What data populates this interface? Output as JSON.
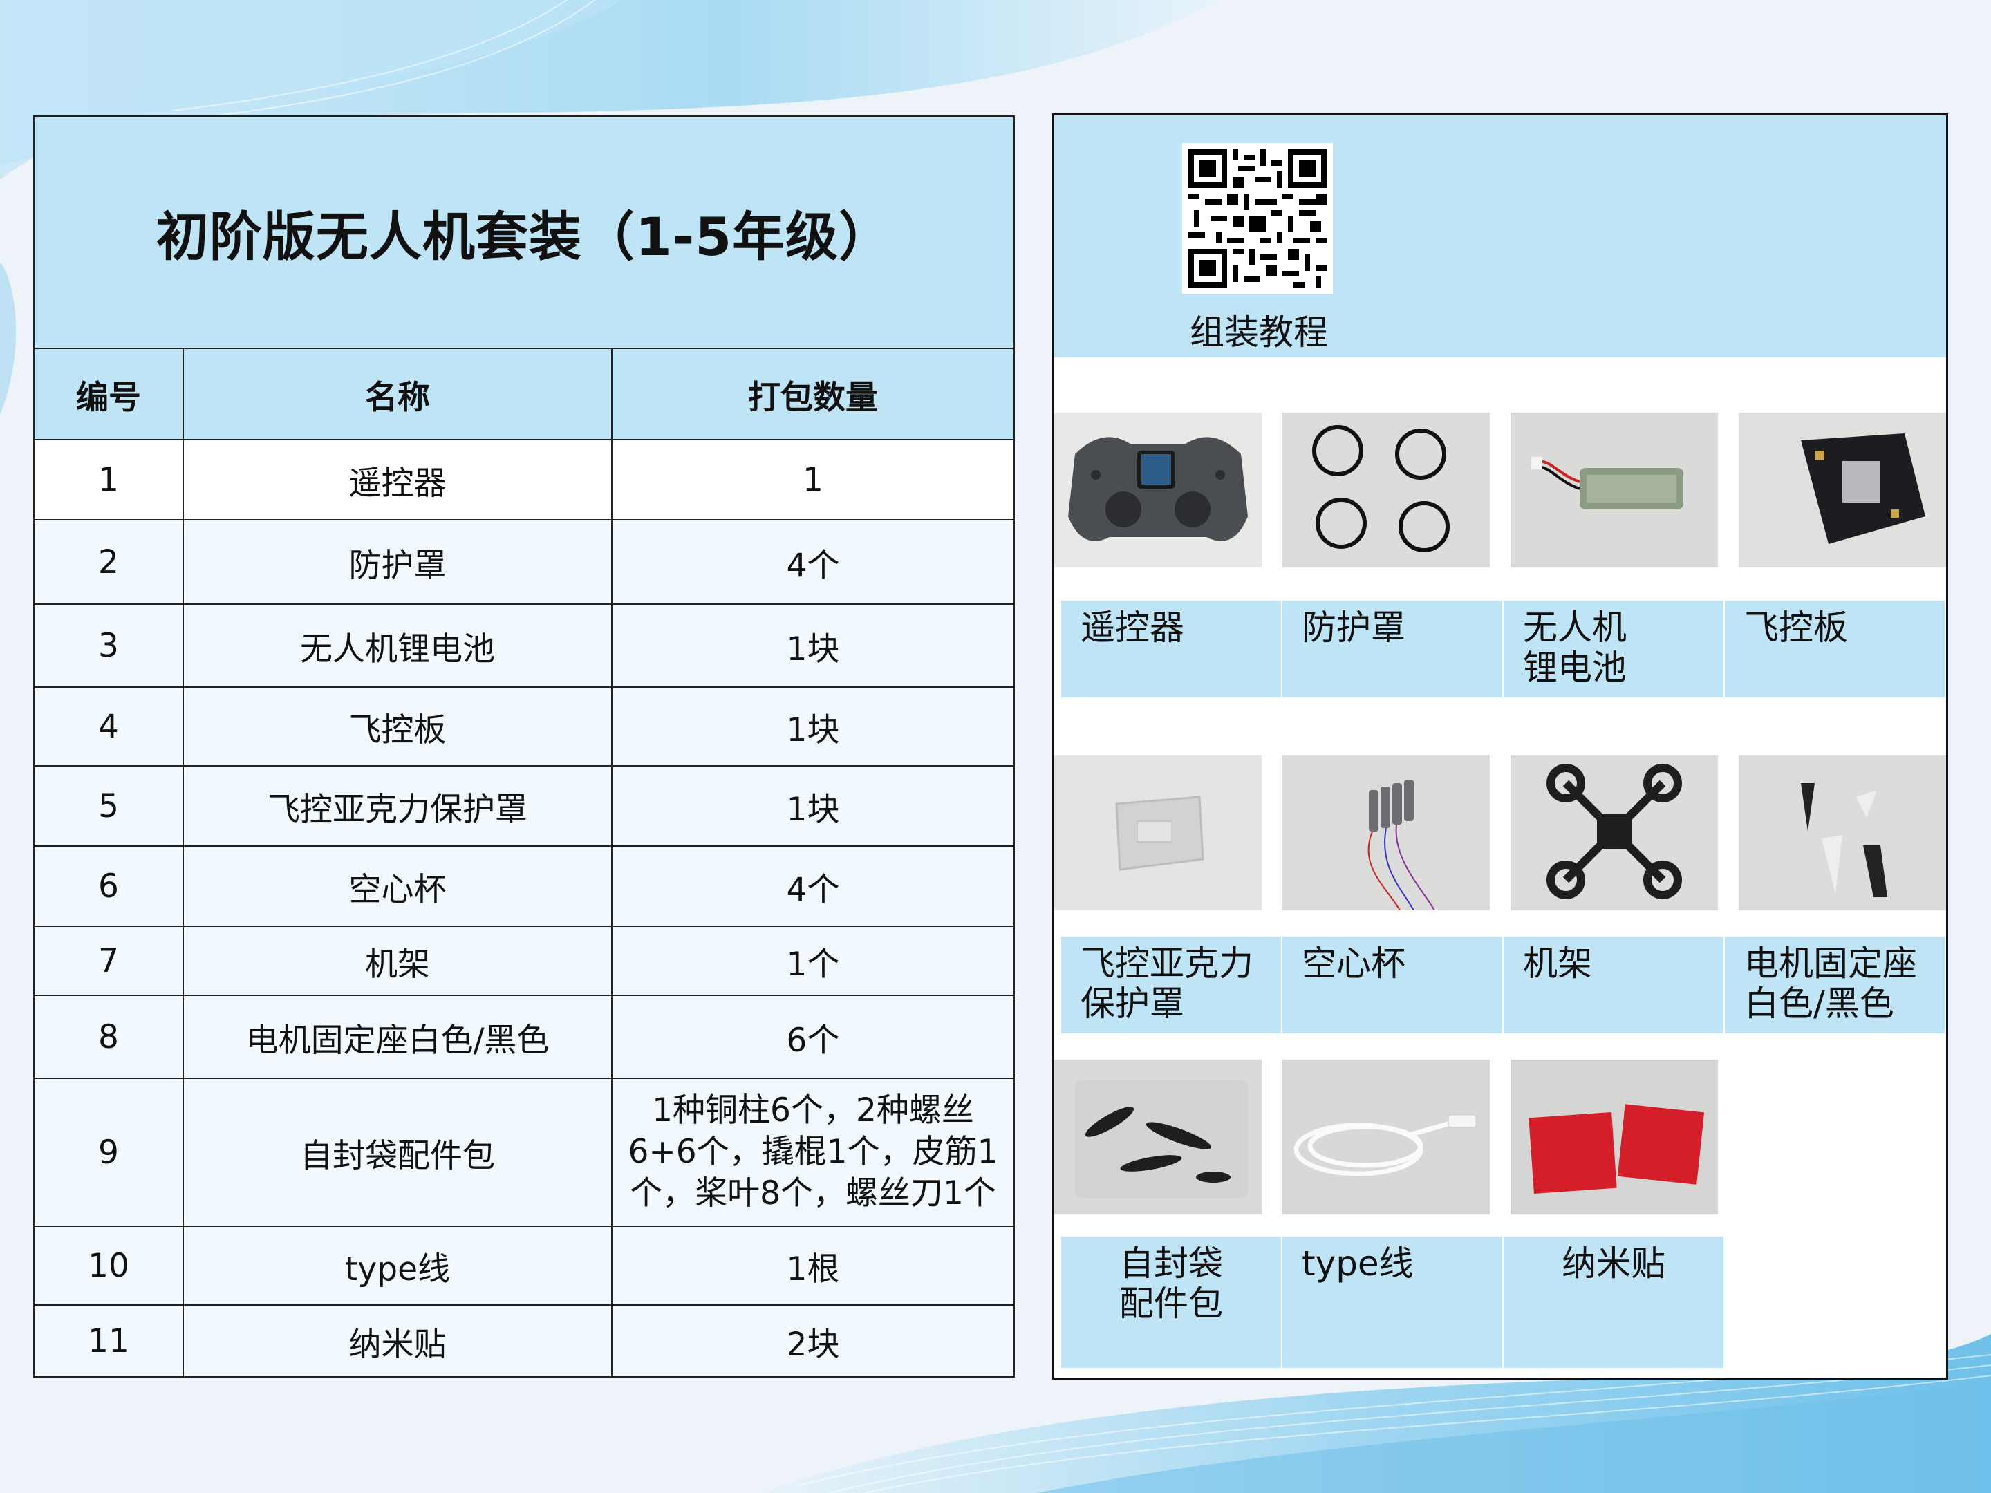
{
  "table": {
    "title": "初阶版无人机套装（1-5年级）",
    "headers": {
      "number": "编号",
      "name": "名称",
      "qty": "打包数量"
    },
    "rows": [
      {
        "no": "1",
        "name": "遥控器",
        "qty": "1"
      },
      {
        "no": "2",
        "name": "防护罩",
        "qty": "4个"
      },
      {
        "no": "3",
        "name": "无人机锂电池",
        "qty": "1块"
      },
      {
        "no": "4",
        "name": "飞控板",
        "qty": "1块"
      },
      {
        "no": "5",
        "name": "飞控亚克力保护罩",
        "qty": "1块"
      },
      {
        "no": "6",
        "name": "空心杯",
        "qty": "4个"
      },
      {
        "no": "7",
        "name": "机架",
        "qty": "1个"
      },
      {
        "no": "8",
        "name": "电机固定座白色/黑色",
        "qty": "6个"
      },
      {
        "no": "9",
        "name": "自封袋配件包",
        "qty": "1种铜柱6个，2种螺丝6+6个，撬棍1个，皮筋1个，桨叶8个，螺丝刀1个"
      },
      {
        "no": "10",
        "name": "type线",
        "qty": "1根"
      },
      {
        "no": "11",
        "name": "纳米贴",
        "qty": "2块"
      }
    ]
  },
  "panel": {
    "qr_caption": "组装教程",
    "items": [
      {
        "label1": "遥控器",
        "label2": "",
        "icon": "remote-controller-photo"
      },
      {
        "label1": "防护罩",
        "label2": "",
        "icon": "propeller-guards-photo"
      },
      {
        "label1": "无人机",
        "label2": "锂电池",
        "icon": "lipo-battery-photo"
      },
      {
        "label1": "飞控板",
        "label2": "",
        "icon": "flight-controller-photo"
      },
      {
        "label1": "飞控亚克力",
        "label2": "保护罩",
        "icon": "acrylic-cover-photo"
      },
      {
        "label1": "空心杯",
        "label2": "",
        "icon": "coreless-motors-photo"
      },
      {
        "label1": "机架",
        "label2": "",
        "icon": "drone-frame-photo"
      },
      {
        "label1": "电机固定座",
        "label2": "白色/黑色",
        "icon": "motor-mounts-photo"
      },
      {
        "label1": "自封袋",
        "label2": "配件包",
        "icon": "accessory-bag-photo"
      },
      {
        "label1": "type线",
        "label2": "",
        "icon": "usb-cable-photo"
      },
      {
        "label1": "纳米贴",
        "label2": "",
        "icon": "nano-tape-photo"
      }
    ]
  }
}
